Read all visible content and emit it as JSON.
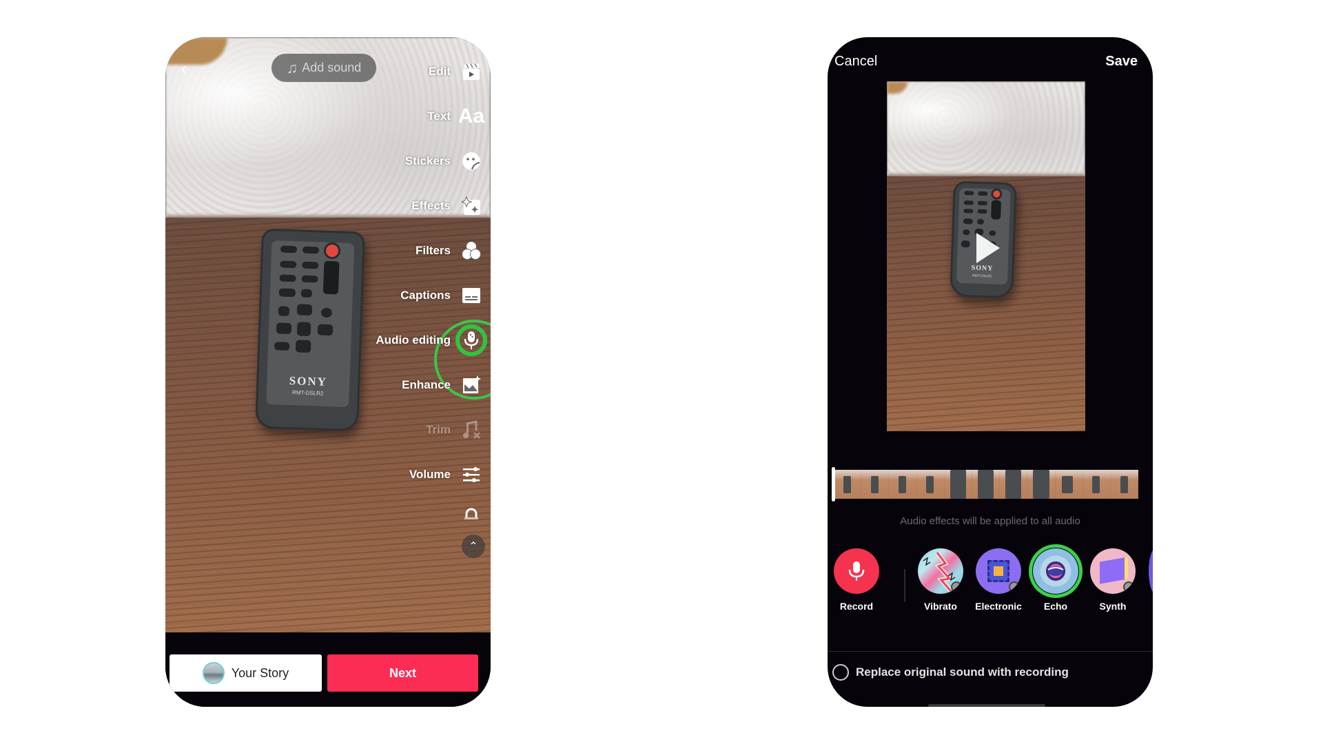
{
  "left_screen": {
    "add_sound_label": "Add sound",
    "menu": [
      {
        "label": "Edit",
        "icon": "clapperboard-icon",
        "disabled": false
      },
      {
        "label": "Text",
        "icon": "text-aa-icon",
        "disabled": false
      },
      {
        "label": "Stickers",
        "icon": "sticker-face-icon",
        "disabled": false
      },
      {
        "label": "Effects",
        "icon": "sparkle-effects-icon",
        "disabled": false
      },
      {
        "label": "Filters",
        "icon": "filters-circles-icon",
        "disabled": false
      },
      {
        "label": "Captions",
        "icon": "captions-icon",
        "disabled": false
      },
      {
        "label": "Audio editing",
        "icon": "microphone-icon",
        "disabled": false,
        "highlighted": true
      },
      {
        "label": "Enhance",
        "icon": "enhance-image-icon",
        "disabled": false
      },
      {
        "label": "Trim",
        "icon": "music-trim-icon",
        "disabled": true
      },
      {
        "label": "Volume",
        "icon": "sliders-icon",
        "disabled": false
      }
    ],
    "text_aa_glyph": "Aa",
    "story_button_label": "Your Story",
    "next_button_label": "Next",
    "remote_brand": "SONY",
    "remote_model": "RMT-DSLR2"
  },
  "right_screen": {
    "cancel_label": "Cancel",
    "save_label": "Save",
    "info_text": "Audio effects will be applied to all audio",
    "effects": [
      {
        "label": "Record",
        "icon": "microphone-icon"
      },
      {
        "label": "Vibrato",
        "icon": "lightning-icon"
      },
      {
        "label": "Electronic",
        "icon": "chip-icon"
      },
      {
        "label": "Echo",
        "icon": "mouth-icon",
        "selected": true
      },
      {
        "label": "Synth",
        "icon": "keyboard-icon"
      }
    ],
    "replace_option_label": "Replace original sound with recording",
    "replace_option_checked": false,
    "remote_brand": "SONY",
    "remote_model": "RMT-DSLR2"
  },
  "colors": {
    "accent_next": "#fd2c55",
    "record_red": "#f5334f",
    "highlight_green": "#3ec44a"
  }
}
